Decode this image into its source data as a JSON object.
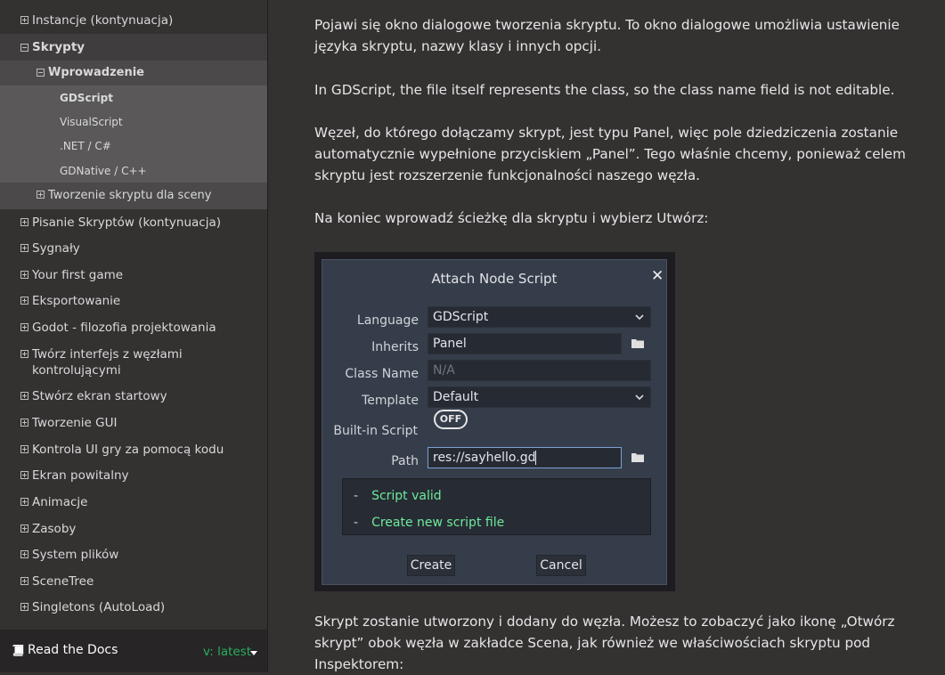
{
  "sidebar": {
    "items": [
      {
        "label": "Instancje (kontynuacja)",
        "expander": "plus"
      },
      {
        "label": "Skrypty",
        "expander": "minus"
      },
      {
        "label": "Wprowadzenie",
        "expander": "minus"
      },
      {
        "label": "GDScript"
      },
      {
        "label": "VisualScript"
      },
      {
        "label": ".NET / C#"
      },
      {
        "label": "GDNative / C++"
      },
      {
        "label": "Tworzenie skryptu dla sceny",
        "expander": "plus"
      },
      {
        "label": "Pisanie Skryptów (kontynuacja)",
        "expander": "plus"
      },
      {
        "label": "Sygnały",
        "expander": "plus"
      },
      {
        "label": "Your first game",
        "expander": "plus"
      },
      {
        "label": "Eksportowanie",
        "expander": "plus"
      },
      {
        "label": "Godot - filozofia projektowania",
        "expander": "plus"
      },
      {
        "label": "Twórz interfejs z węzłami",
        "label2": "kontrolującymi",
        "expander": "plus"
      },
      {
        "label": "Stwórz ekran startowy",
        "expander": "plus"
      },
      {
        "label": "Tworzenie GUI",
        "expander": "plus"
      },
      {
        "label": "Kontrola UI gry za pomocą kodu",
        "expander": "plus"
      },
      {
        "label": "Ekran powitalny",
        "expander": "plus"
      },
      {
        "label": "Animacje",
        "expander": "plus"
      },
      {
        "label": "Zasoby",
        "expander": "plus"
      },
      {
        "label": "System plików",
        "expander": "plus"
      },
      {
        "label": "SceneTree",
        "expander": "plus"
      },
      {
        "label": "Singletons (AutoLoad)",
        "expander": "plus"
      }
    ]
  },
  "footer": {
    "rtd_label": "Read the Docs",
    "version": "v: latest",
    "icon": "book-icon"
  },
  "content": {
    "p1": "Pojawi się okno dialogowe tworzenia skryptu. To okno dialogowe umożliwia ustawienie języka skryptu, nazwy klasy i innych opcji.",
    "p2": "In GDScript, the file itself represents the class, so the class name field is not editable.",
    "p3": "Węzeł, do którego dołączamy skrypt, jest typu Panel, więc pole dziedziczenia zostanie automatycznie wypełnione przyciskiem „Panel”. Tego właśnie chcemy, ponieważ celem skryptu jest rozszerzenie funkcjonalności naszego węzła.",
    "p4": "Na koniec wprowadź ścieżkę dla skryptu i wybierz Utwórz:",
    "p5": "Skrypt zostanie utworzony i dodany do węzła. Możesz to zobaczyć jako ikonę „Otwórz skrypt” obok węzła w zakładce Scena, jak również we właściwościach skryptu pod Inspektorem:"
  },
  "dialog": {
    "title": "Attach Node Script",
    "close": "✕",
    "language_label": "Language",
    "language_value": "GDScript",
    "inherits_label": "Inherits",
    "inherits_value": "Panel",
    "classname_label": "Class Name",
    "classname_value": "N/A",
    "template_label": "Template",
    "template_value": "Default",
    "builtin_label": "Built-in Script",
    "builtin_toggle": "OFF",
    "path_label": "Path",
    "path_value": "res://sayhello.gd",
    "status": [
      {
        "dash": "-",
        "text": "Script valid"
      },
      {
        "dash": "-",
        "text": "Create new script file"
      }
    ],
    "create_button": "Create",
    "cancel_button": "Cancel"
  }
}
